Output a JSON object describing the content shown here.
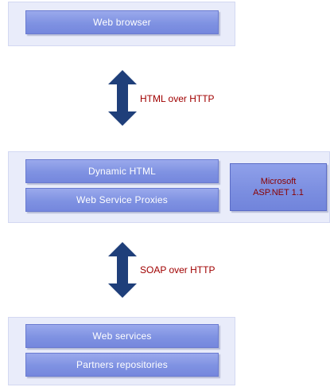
{
  "top_tier": {
    "layers": [
      "Web browser"
    ]
  },
  "arrows": {
    "upper_label": "HTML over HTTP",
    "lower_label": "SOAP over HTTP",
    "color": "#1f3f7a"
  },
  "middle_tier": {
    "layers": [
      "Dynamic HTML",
      "Web Service Proxies"
    ],
    "side_box": {
      "line1": "Microsoft",
      "line2": "ASP.NET 1.1"
    }
  },
  "bottom_tier": {
    "layers": [
      "Web services",
      "Partners repositories"
    ]
  },
  "colors": {
    "panel": "#e9ecfa",
    "layer": "#7f92e2",
    "label_text": "#a00000"
  }
}
